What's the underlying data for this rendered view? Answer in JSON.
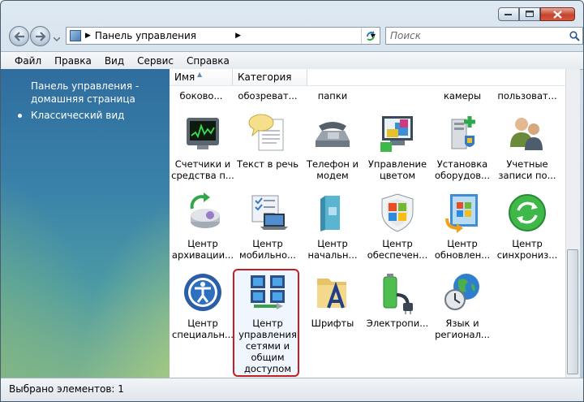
{
  "window": {
    "controls": [
      "minimize",
      "maximize",
      "close"
    ]
  },
  "address": {
    "path": "Панель управления",
    "separator": "▶"
  },
  "search": {
    "placeholder": "Поиск"
  },
  "menu": [
    "Файл",
    "Правка",
    "Вид",
    "Сервис",
    "Справка"
  ],
  "sidebar": {
    "home_link": "Панель управления - домашняя страница",
    "classic_view": "Классический вид"
  },
  "columns": {
    "name": "Имя",
    "category": "Категория"
  },
  "partial_row": [
    "боково...",
    "обозреват...",
    "папки",
    "камеры",
    "пользоват..."
  ],
  "items": [
    {
      "label": "Счетчики и\nсредства п...",
      "icon": "performance-icon"
    },
    {
      "label": "Текст в речь",
      "icon": "text-to-speech-icon"
    },
    {
      "label": "Телефон и\nмодем",
      "icon": "phone-modem-icon"
    },
    {
      "label": "Управление\nцветом",
      "icon": "color-management-icon"
    },
    {
      "label": "Установка\nоборудов...",
      "icon": "add-hardware-icon"
    },
    {
      "label": "Учетные\nзаписи по...",
      "icon": "user-accounts-icon"
    },
    {
      "label": "Центр\nархивации...",
      "icon": "backup-center-icon"
    },
    {
      "label": "Центр\nмобильно...",
      "icon": "mobility-center-icon"
    },
    {
      "label": "Центр\nначальн...",
      "icon": "welcome-center-icon"
    },
    {
      "label": "Центр\nобеспечен...",
      "icon": "security-center-icon"
    },
    {
      "label": "Центр\nобновлен...",
      "icon": "windows-update-icon"
    },
    {
      "label": "Центр\nсинхрониз...",
      "icon": "sync-center-icon"
    },
    {
      "label": "Центр\nспециальн...",
      "icon": "ease-of-access-icon"
    },
    {
      "label": "Центр\nуправления\nсетями и\nобщим\nдоступом",
      "icon": "network-center-icon",
      "selected": true
    },
    {
      "label": "Шрифты",
      "icon": "fonts-icon"
    },
    {
      "label": "Электропи...",
      "icon": "power-options-icon"
    },
    {
      "label": "Язык и\nрегионал...",
      "icon": "regional-options-icon"
    }
  ],
  "status": {
    "text": "Выбрано элементов: 1"
  },
  "colors": {
    "selection_border": "#c41e24",
    "sidebar_top": "#2f6d9e"
  }
}
